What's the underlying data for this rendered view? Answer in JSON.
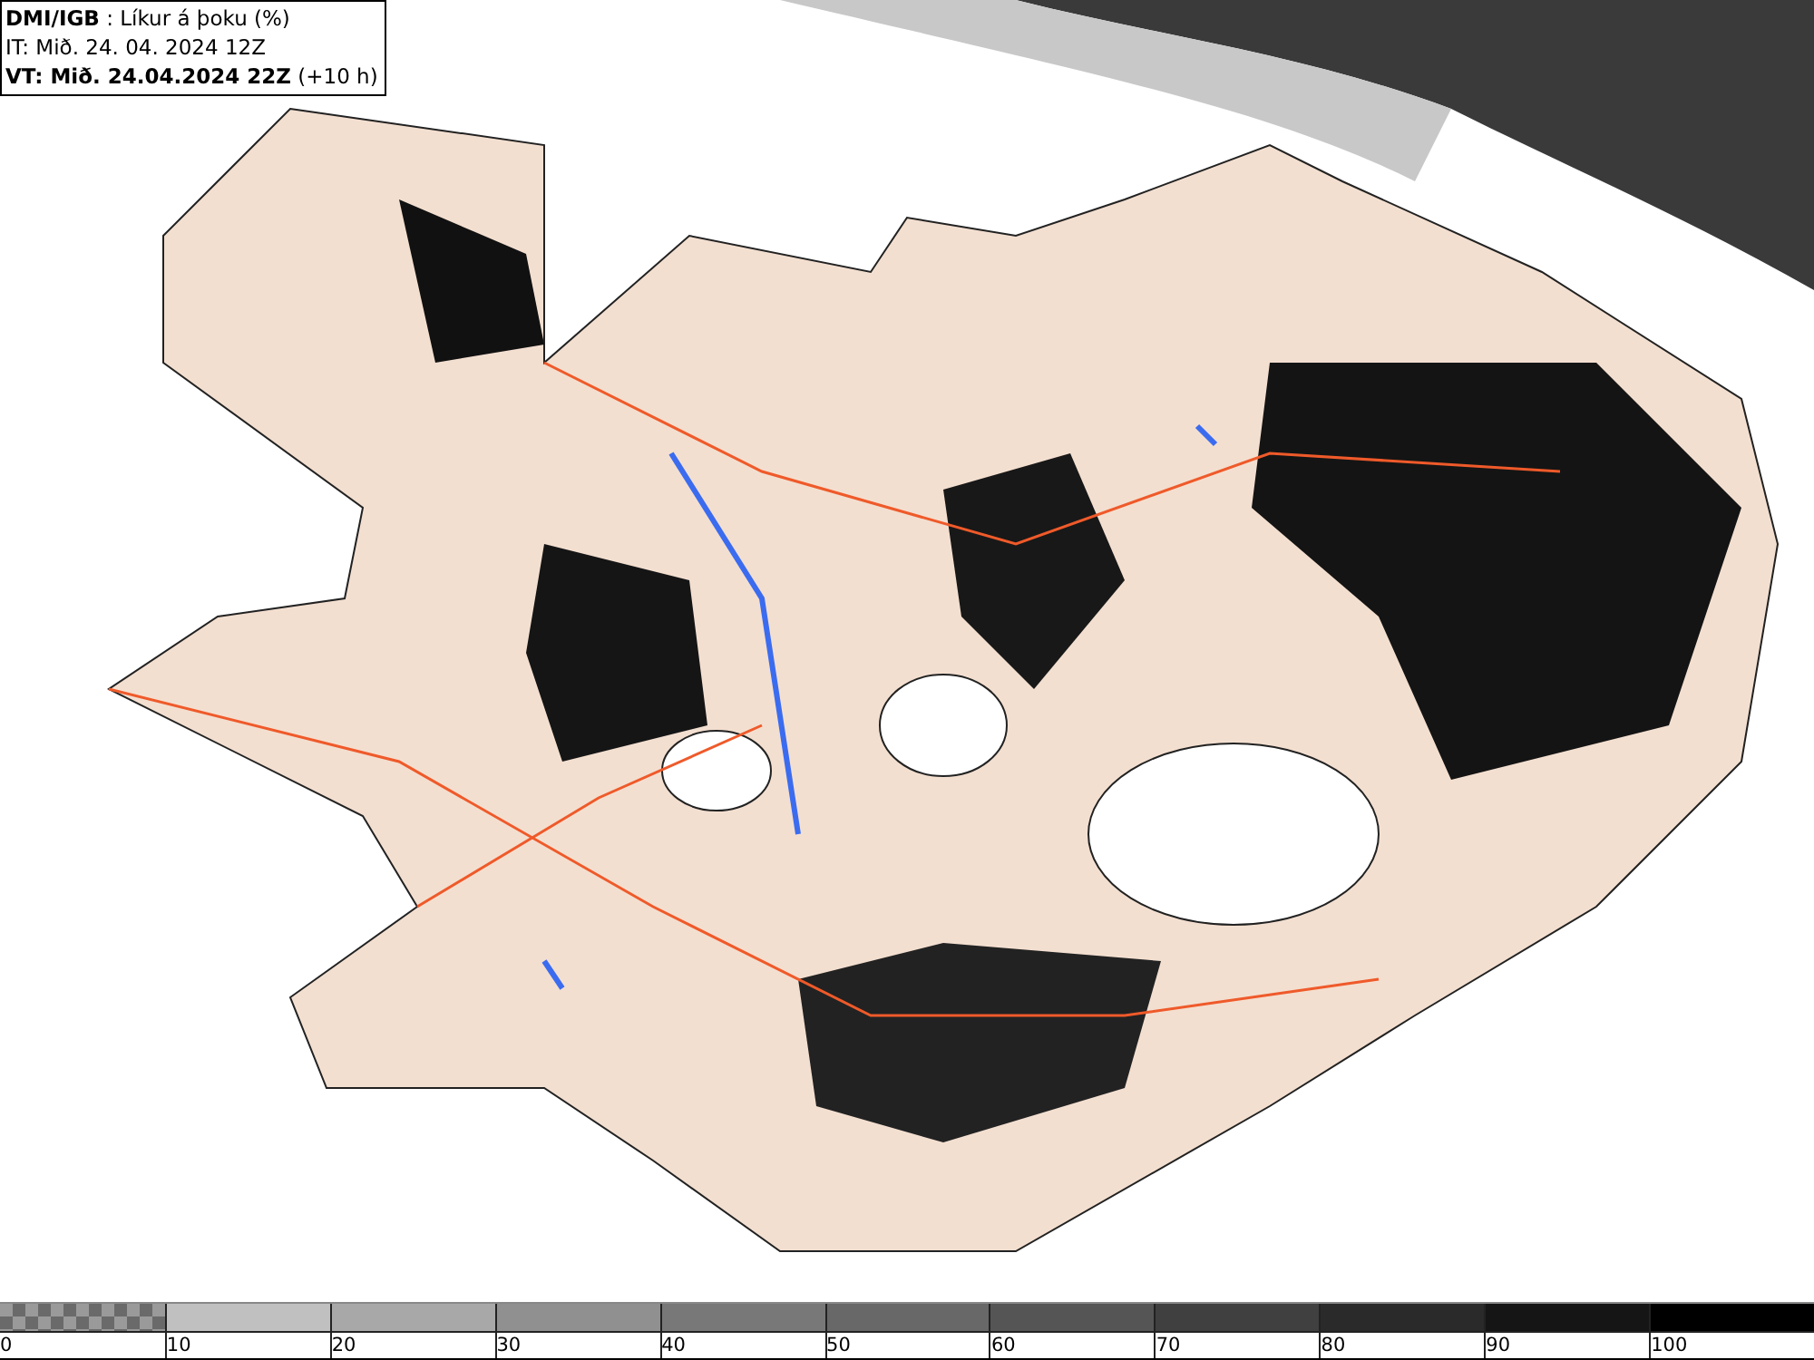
{
  "header": {
    "lines": [
      "**DMI/IGB** : Líkur á þoku (%)",
      "IT: Mið. 24. 04. 2024 12Z",
      "**VT: Mið. 24.04.2024 22Z** (+10 h)"
    ]
  },
  "legend": {
    "bins": [
      {
        "label": "0",
        "kind": "checker",
        "color": "#6a6a6a"
      },
      {
        "label": "10",
        "kind": "solid",
        "color": "#c0c0c0"
      },
      {
        "label": "20",
        "kind": "solid",
        "color": "#a8a8a8"
      },
      {
        "label": "30",
        "kind": "solid",
        "color": "#909090"
      },
      {
        "label": "40",
        "kind": "solid",
        "color": "#787878"
      },
      {
        "label": "50",
        "kind": "solid",
        "color": "#686868"
      },
      {
        "label": "60",
        "kind": "solid",
        "color": "#555555"
      },
      {
        "label": "70",
        "kind": "solid",
        "color": "#404040"
      },
      {
        "label": "80",
        "kind": "solid",
        "color": "#2a2a2a"
      },
      {
        "label": "90",
        "kind": "solid",
        "color": "#151515"
      },
      {
        "label": "100",
        "kind": "solid",
        "color": "#000000"
      }
    ]
  }
}
